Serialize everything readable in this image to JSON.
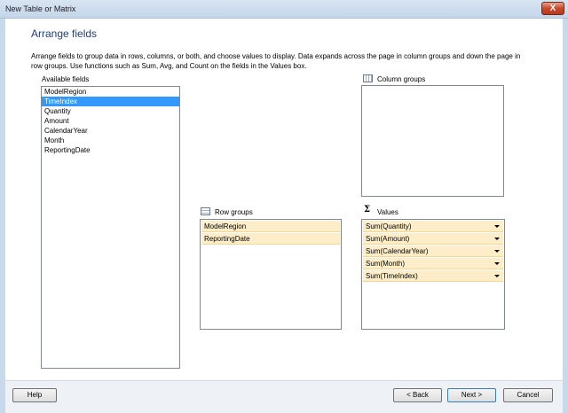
{
  "window": {
    "title": "New Table or Matrix",
    "close_label": "X"
  },
  "page": {
    "heading": "Arrange fields",
    "description": "Arrange fields to group data in rows, columns, or both, and choose values to display. Data expands across the page in column groups and down the page in row groups.  Use functions such as Sum, Avg, and Count on the fields in the Values box."
  },
  "available_fields": {
    "label": "Available fields",
    "items": [
      "ModelRegion",
      "TimeIndex",
      "Quantity",
      "Amount",
      "CalendarYear",
      "Month",
      "ReportingDate"
    ],
    "selected": "TimeIndex"
  },
  "column_groups": {
    "label": "Column groups",
    "icon": "column-grid-icon",
    "items": []
  },
  "row_groups": {
    "label": "Row groups",
    "icon": "row-grid-icon",
    "items": [
      "ModelRegion",
      "ReportingDate"
    ]
  },
  "values": {
    "label": "Values",
    "icon": "sigma-icon",
    "items": [
      "Sum(Quantity)",
      "Sum(Amount)",
      "Sum(CalendarYear)",
      "Sum(Month)",
      "Sum(TimeIndex)"
    ]
  },
  "buttons": {
    "help": "Help",
    "back": "< Back",
    "next": "Next >",
    "cancel": "Cancel"
  },
  "colors": {
    "selection": "#3399ff",
    "zone_item": "#fdeec9",
    "heading": "#1f3f7a"
  }
}
